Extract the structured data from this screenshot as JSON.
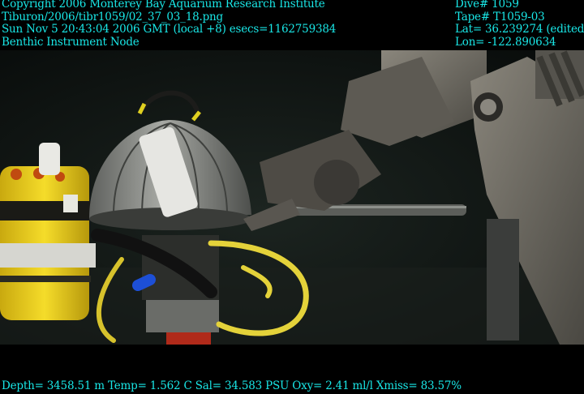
{
  "overlay": {
    "top_left": [
      "Copyright 2006 Monterey Bay Aquarium Research Institute",
      "Tiburon/2006/tibr1059/02_37_03_18.png",
      "Sun Nov  5 20:43:04 2006 GMT (local +8)  esecs=1162759384",
      "Benthic Instrument Node"
    ],
    "top_right": [
      "Dive# 1059",
      "Tape# T1059-03",
      "Lat= 36.239274 (edited)",
      "Lon= -122.890634"
    ],
    "bottom": "Depth= 3458.51 m  Temp= 1.562 C  Sal= 34.583 PSU  Oxy= 2.41 ml/l  Xmiss= 83.57%"
  },
  "colors": {
    "overlay_text": "#19e6e6",
    "water": "#0e1412",
    "instrument_yellow": "#f2d21a",
    "dome_gray": "#8c8e8a",
    "arm_gray": "#6d6a62",
    "cable_yellow": "#e4d23a"
  }
}
